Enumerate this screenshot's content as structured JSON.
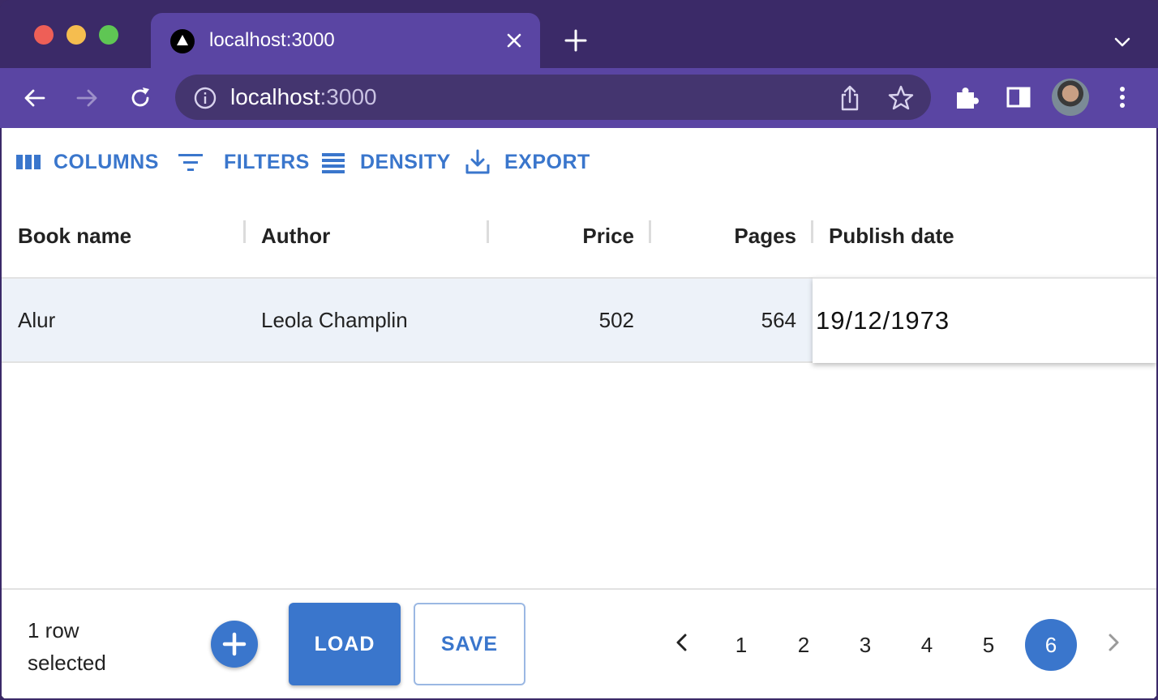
{
  "browser": {
    "tab_title": "localhost:3000",
    "url_host": "localhost",
    "url_port": ":3000"
  },
  "grid_toolbar": {
    "columns": "COLUMNS",
    "filters": "FILTERS",
    "density": "DENSITY",
    "export": "EXPORT"
  },
  "columns": [
    "Book name",
    "Author",
    "Price",
    "Pages",
    "Publish date"
  ],
  "rows": [
    {
      "book_name": "Alur",
      "author": "Leola Champlin",
      "price": "502",
      "pages": "564",
      "publish_date": "19/12/1973"
    }
  ],
  "footer": {
    "selection_text": "1 row selected",
    "load_label": "LOAD",
    "save_label": "SAVE",
    "pages": [
      "1",
      "2",
      "3",
      "4",
      "5",
      "6"
    ],
    "current_page": "6"
  },
  "colors": {
    "accent": "#3a76cc",
    "browser_frame": "#3b2a68",
    "browser_toolbar": "#5a45a3",
    "selected_row": "#edf2f9"
  }
}
